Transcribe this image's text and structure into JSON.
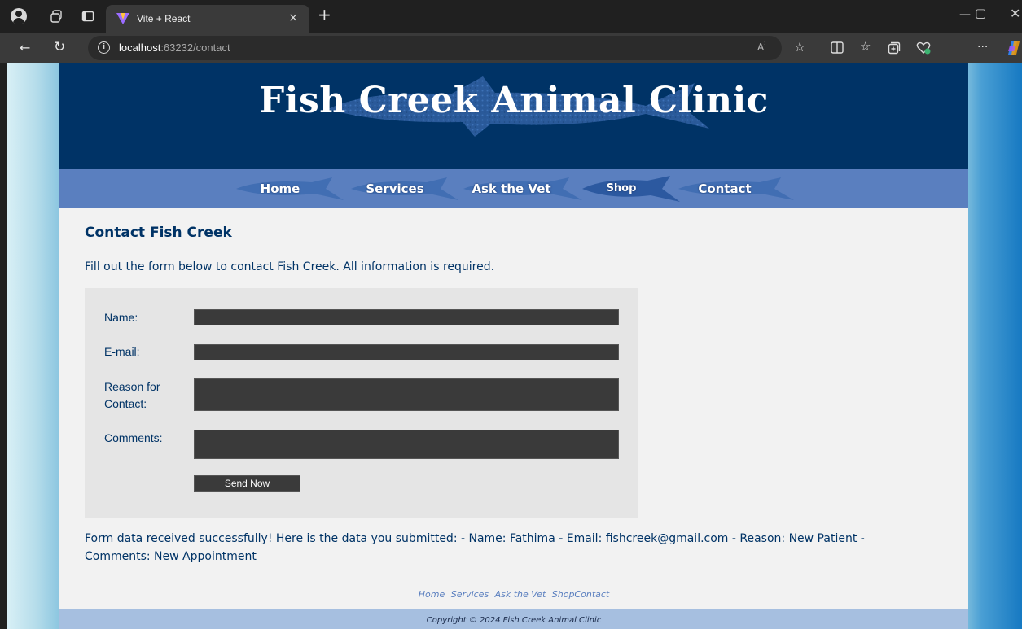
{
  "browser": {
    "tab_title": "Vite + React",
    "tab_close": "×",
    "new_tab": "+",
    "url_host": "localhost",
    "url_rest": ":63232/contact"
  },
  "site": {
    "title": "Fish Creek Animal Clinic",
    "nav": [
      "Home",
      "Services",
      "Ask the Vet",
      "Shop",
      "Contact"
    ],
    "heading": "Contact Fish Creek",
    "intro": "Fill out the form below to contact Fish Creek. All information is required.",
    "form": {
      "name_label": "Name:",
      "email_label": "E-mail:",
      "reason_label_1": "Reason for",
      "reason_label_2": "Contact:",
      "comments_label": "Comments:",
      "submit_label": "Send Now"
    },
    "result": "Form data received successfully! Here is the data you submitted: - Name: Fathima - Email: fishcreek@gmail.com - Reason: New Patient - Comments: New Appointment",
    "footer_nav": [
      "Home",
      "Services",
      "Ask the Vet",
      "ShopContact"
    ],
    "copyright": "Copyright © 2024 Fish Creek Animal Clinic"
  },
  "colors": {
    "header": "#003366",
    "nav": "#5a7fbf",
    "content_bg": "#f2f2f2",
    "text": "#003366"
  }
}
